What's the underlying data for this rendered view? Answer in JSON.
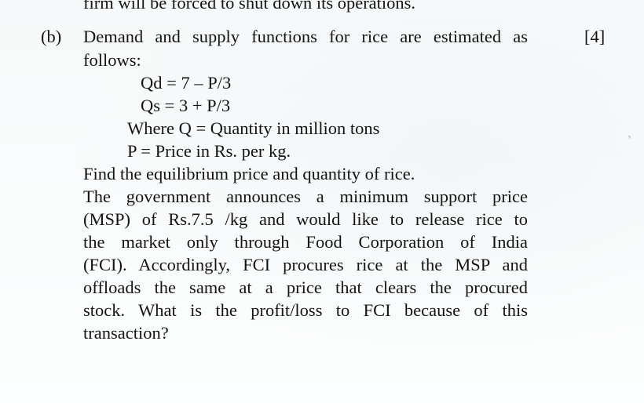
{
  "previous_text": "firm will be forced to shut down its operations.",
  "question": {
    "label": "(b)",
    "marks": "[4]",
    "intro_line1": "Demand and supply functions for rice are estimated as",
    "intro_line2": "follows:",
    "eq_demand": "Qd = 7 – P/3",
    "eq_supply": "Qs = 3 + P/3",
    "where_q": "Where Q = Quantity in million tons",
    "where_p": "P = Price in Rs. per kg.",
    "find_line": "Find the equilibrium price and quantity of rice.",
    "paragraph_lines": [
      "The government announces a minimum support price",
      "(MSP) of Rs.7.5 /kg and would like to release rice to",
      "the market only through Food Corporation of India",
      "(FCI). Accordingly, FCI procures rice at the MSP and",
      "offloads the same at a price that clears the procured",
      "stock. What is the profit/loss to FCI because of this",
      "transaction?"
    ]
  }
}
